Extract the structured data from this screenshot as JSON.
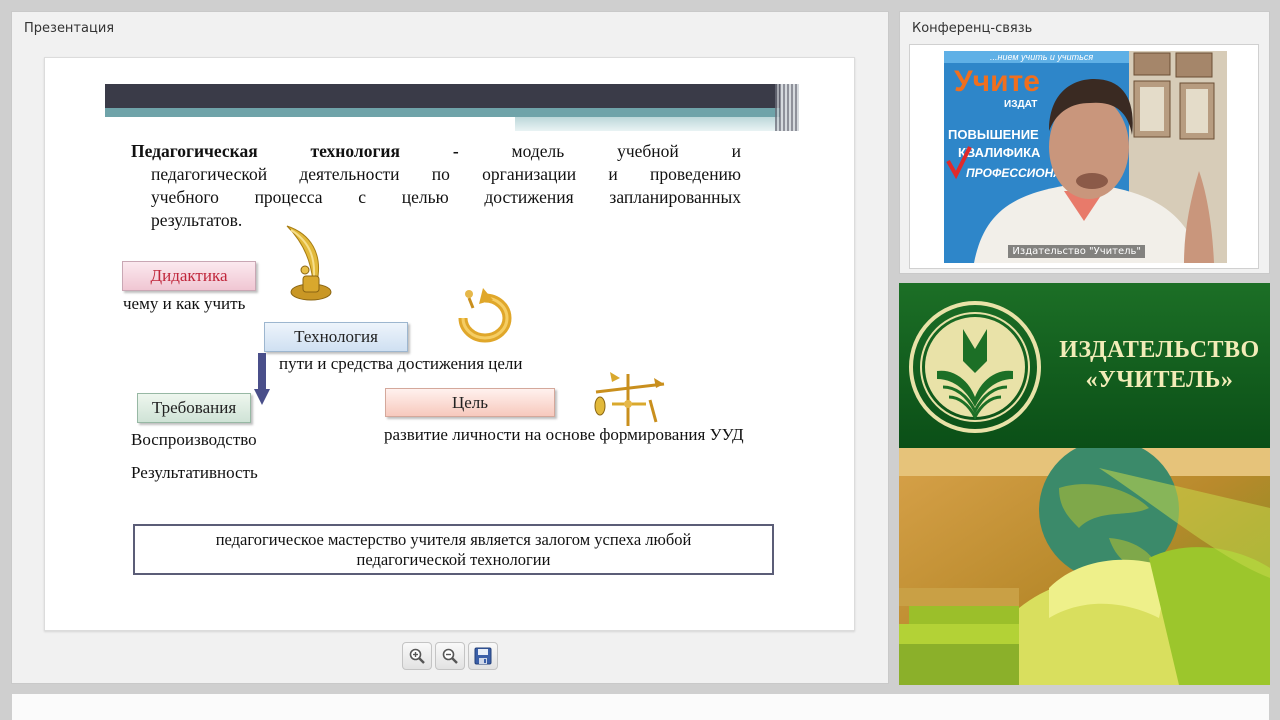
{
  "presentation": {
    "title": "Презентация",
    "slide": {
      "definition": {
        "term": "Педагогическая технология",
        "dash": "-",
        "line1_rest": "модель учебной и",
        "line2": "педагогической деятельности по организации и проведению",
        "line3": "учебного процесса с целью достижения запланированных",
        "line4": "результатов."
      },
      "didaktika": {
        "label": "Дидактика",
        "text": "чему и как учить"
      },
      "technologiya": {
        "label": "Технология",
        "text": "пути и средства достижения цели"
      },
      "trebovaniya": {
        "label": "Требования",
        "items": [
          "Воспроизводство",
          "Результативность"
        ]
      },
      "cel": {
        "label": "Цель",
        "text": "развитие личности на основе формирования УУД"
      },
      "footer_line1": "педагогическое мастерство учителя является залогом успеха любой",
      "footer_line2": "педагогической технологии"
    },
    "toolbar": {
      "zoom_in": "zoom-in-icon",
      "zoom_out": "zoom-out-icon",
      "save": "save-icon"
    }
  },
  "conference": {
    "title": "Конференц-связь",
    "caption": "Издательство \"Учитель\"",
    "backdrop_text": [
      "Учите",
      "ИЗДАТ",
      "ПОВЫШЕНИЕ",
      "КВАЛИФИКА",
      "ПРОФЕССИОНАЛ"
    ],
    "backdrop_slogan": "...нием учить и учиться"
  },
  "banner": {
    "name_line1": "ИЗДАТЕЛЬСТВО",
    "name_line2": "«УЧИТЕЛЬ»"
  },
  "colors": {
    "slide_bar_dark": "#3a3b48",
    "slide_bar_teal": "#6fa3a9",
    "banner_green": "#0f5a1e",
    "banner_text": "#f2ecb8"
  }
}
